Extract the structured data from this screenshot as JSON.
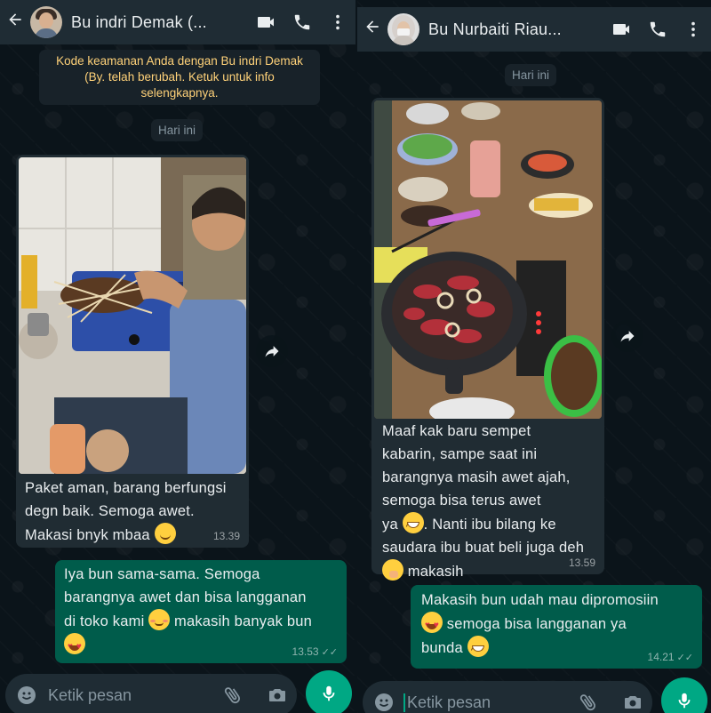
{
  "left": {
    "contact_name": "Bu indri Demak (...",
    "system_notice": "Kode keamanan Anda dengan Bu indri Demak (By. telah berubah. Ketuk untuk info selengkapnya.",
    "date_chip": "Hari ini",
    "incoming": {
      "line1": "Paket aman, barang berfungsi",
      "line2": "degn baik. Semoga awet.",
      "line3": "Makasi bnyk mbaa",
      "time": "13.39"
    },
    "outgoing": {
      "line1": "Iya bun sama-sama. Semoga",
      "line2": "barangnya awet dan bisa langganan",
      "line3": "di toko kami",
      "line3b": "makasih banyak bun",
      "time": "13.53"
    },
    "input_placeholder": "Ketik pesan"
  },
  "right": {
    "contact_name": "Bu Nurbaiti Riau...",
    "date_chip": "Hari ini",
    "incoming": {
      "line1": "Maaf kak baru sempet",
      "line2": "kabarin, sampe saat ini",
      "line3": "barangnya masih awet ajah,",
      "line4": "semoga bisa terus awet",
      "line5a": "ya",
      "line5b": ". Nanti ibu bilang ke",
      "line6": "saudara ibu buat beli juga deh",
      "line7": "makasih",
      "time": "13.59"
    },
    "outgoing": {
      "line1": "Makasih bun udah mau dipromosiin",
      "line2": "semoga bisa langganan ya",
      "line3": "bunda",
      "time": "14.21"
    },
    "input_placeholder": "Ketik pesan"
  },
  "icons": {
    "back": "arrow-left-icon",
    "video": "video-call-icon",
    "call": "phone-icon",
    "menu": "more-vertical-icon",
    "forward": "forward-icon",
    "emoji": "emoji-icon",
    "attach": "paperclip-icon",
    "camera": "camera-icon",
    "mic": "mic-icon"
  },
  "colors": {
    "header": "#1f2c34",
    "incoming_bubble": "#202c33",
    "outgoing_bubble": "#005c4b",
    "accent": "#00a884",
    "security_text": "#ffd279"
  }
}
